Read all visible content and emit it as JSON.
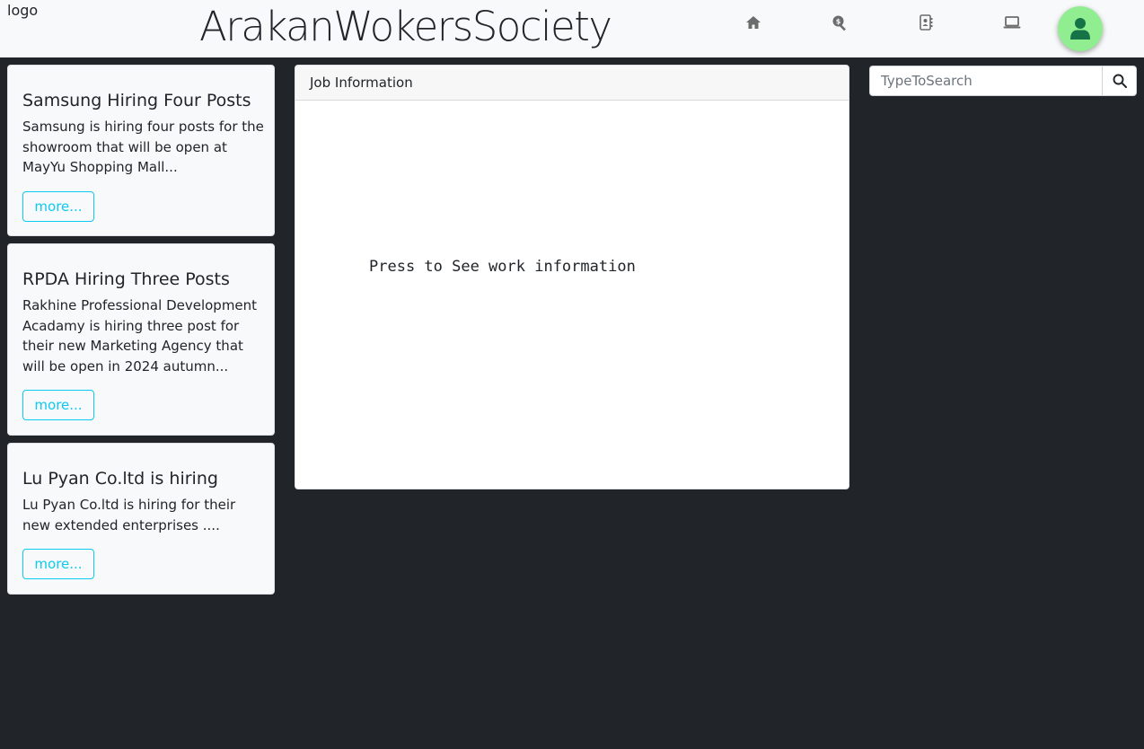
{
  "navbar": {
    "logo_alt": "logo",
    "brand": "ArakanWokersSociety",
    "icons": [
      "home-icon",
      "search-dollar-icon",
      "contacts-icon",
      "laptop-icon"
    ],
    "avatar_color": "#90ee90"
  },
  "cards": [
    {
      "title": "Samsung Hiring Four Posts",
      "text": "Samsung is hiring four posts for the showroom that will be open at MayYu Shopping Mall...",
      "button": "more..."
    },
    {
      "title": "RPDA Hiring Three Posts",
      "text": "Rakhine Professional Development Acadamy is hiring three post for their new Marketing Agency that will be open in 2024 autumn...",
      "button": "more..."
    },
    {
      "title": "Lu Pyan Co.ltd is hiring",
      "text": "Lu Pyan Co.ltd is hiring for their new extended enterprises ....",
      "button": "more..."
    }
  ],
  "job_panel": {
    "header": "Job Information",
    "body": "Press to See work information"
  },
  "search": {
    "placeholder": "TypeToSearch",
    "value": ""
  },
  "colors": {
    "background": "#212529",
    "navbar": "#f8f9fa",
    "accent": "#0dcaf0"
  }
}
